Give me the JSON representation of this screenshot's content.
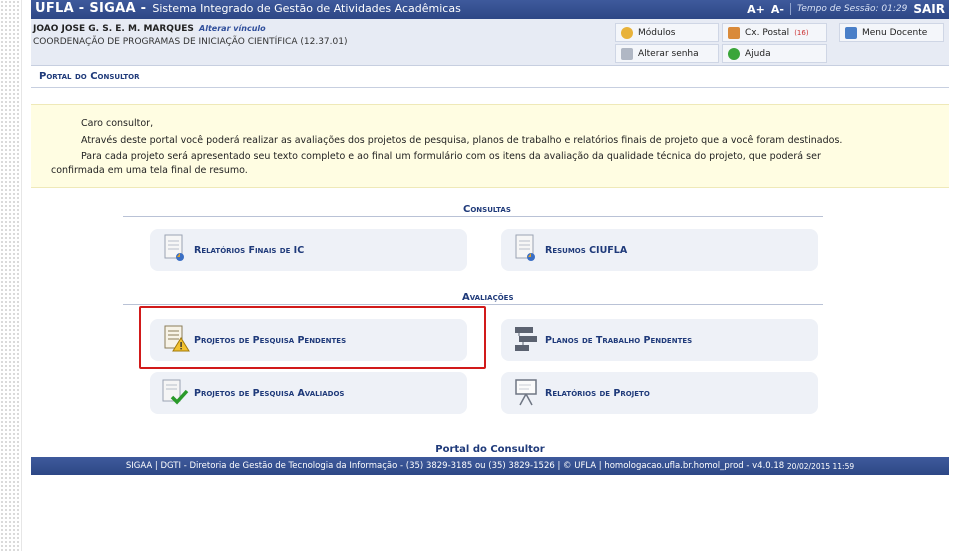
{
  "header": {
    "brand": "UFLA - SIGAA -",
    "system_name": "Sistema Integrado de Gestão de Atividades Acadêmicas",
    "font_up": "A+",
    "font_down": "A-",
    "session_label": "Tempo de Sessão: 01:29",
    "logout": "SAIR"
  },
  "user": {
    "name": "JOAO JOSE G. S. E. M. MARQUES",
    "change_link": "Alterar vínculo",
    "unit": "COORDENAÇÃO DE PROGRAMAS DE INICIAÇÃO CIENTÍFICA (12.37.01)"
  },
  "toolbar": {
    "modulos": "Módulos",
    "caixa_postal": "Cx. Postal",
    "caixa_postal_count": "(16)",
    "menu_docente": "Menu Docente",
    "alterar_senha": "Alterar senha",
    "ajuda": "Ajuda"
  },
  "portal_title": "Portal do Consultor",
  "info": {
    "greeting": "Caro consultor,",
    "line1": "Através deste portal você poderá realizar as avaliações dos projetos de pesquisa, planos de trabalho e relatórios finais de projeto que a você foram destinados.",
    "line2": "Para cada projeto será apresentado seu texto completo e ao final um formulário com os itens da avaliação da qualidade técnica do projeto, que poderá ser",
    "line3": "confirmada em uma tela final de resumo."
  },
  "sections": {
    "consultas": "Consultas",
    "avaliacoes": "Avaliações"
  },
  "cards": {
    "relatorios_finais": "Relatórios Finais de IC",
    "resumos": "Resumos CIUFLA",
    "projetos_pendentes": "Projetos de Pesquisa Pendentes",
    "planos_pendentes": "Planos de Trabalho Pendentes",
    "projetos_avaliados": "Projetos de Pesquisa Avaliados",
    "relatorios_projeto": "Relatórios de Projeto"
  },
  "footer": {
    "title": "Portal do Consultor",
    "text": "SIGAA | DGTI - Diretoria de Gestão de Tecnologia da Informação - (35) 3829-3185 ou (35) 3829-1526 | © UFLA | homologacao.ufla.br.homol_prod - v4.0.18",
    "timestamp": "20/02/2015 11:59"
  },
  "colors": {
    "header_bg": "#2d4785",
    "accent_text": "#1f3a7a",
    "info_bg": "#fffde2",
    "highlight": "#d11a1a"
  }
}
